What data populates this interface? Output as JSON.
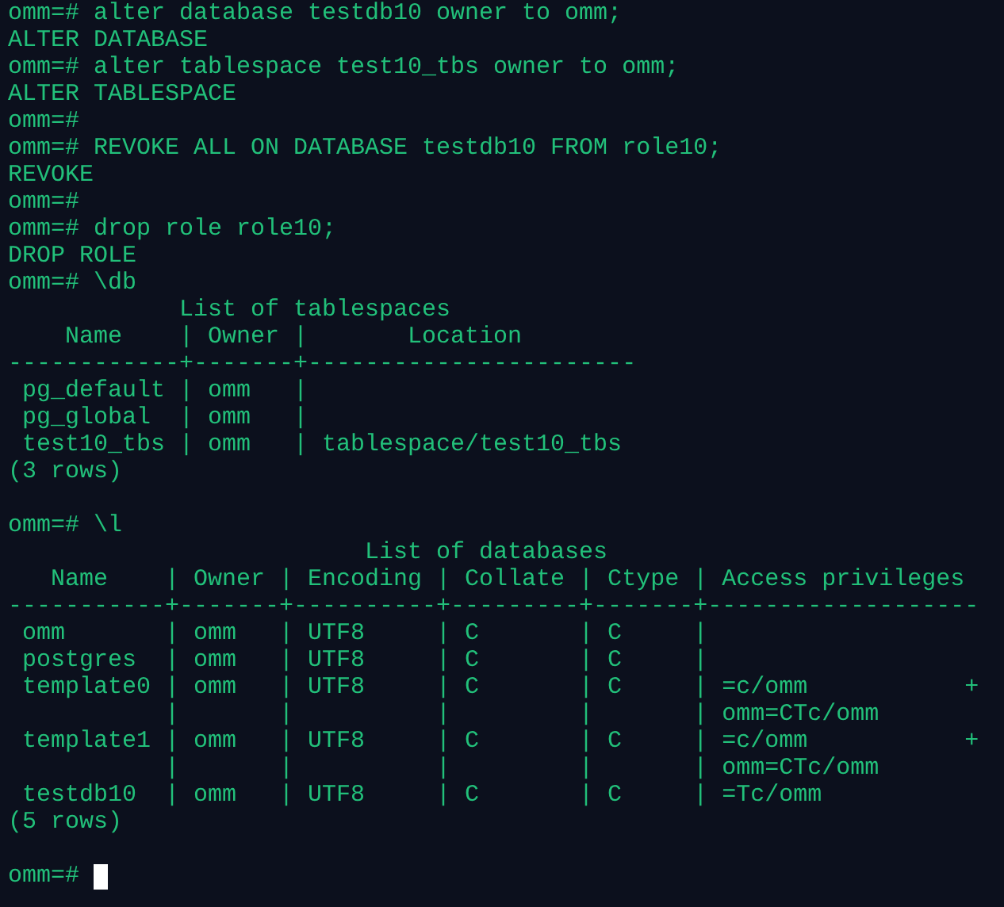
{
  "terminal": {
    "lines": [
      {
        "kind": "text",
        "text": "omm=# alter database testdb10 owner to omm;"
      },
      {
        "kind": "text",
        "text": "ALTER DATABASE"
      },
      {
        "kind": "text",
        "text": "omm=# alter tablespace test10_tbs owner to omm;"
      },
      {
        "kind": "text",
        "text": "ALTER TABLESPACE"
      },
      {
        "kind": "text",
        "text": "omm=#"
      },
      {
        "kind": "text",
        "text": "omm=# REVOKE ALL ON DATABASE testdb10 FROM role10;"
      },
      {
        "kind": "text",
        "text": "REVOKE"
      },
      {
        "kind": "text",
        "text": "omm=#"
      },
      {
        "kind": "text",
        "text": "omm=# drop role role10;"
      },
      {
        "kind": "text",
        "text": "DROP ROLE"
      },
      {
        "kind": "text",
        "text": "omm=# \\db"
      },
      {
        "kind": "text",
        "text": "            List of tablespaces"
      },
      {
        "kind": "text",
        "text": "    Name    | Owner |       Location"
      },
      {
        "kind": "text",
        "text": "------------+-------+-----------------------"
      },
      {
        "kind": "text",
        "text": " pg_default | omm   |"
      },
      {
        "kind": "text",
        "text": " pg_global  | omm   |"
      },
      {
        "kind": "text",
        "text": " test10_tbs | omm   | tablespace/test10_tbs"
      },
      {
        "kind": "text",
        "text": "(3 rows)"
      },
      {
        "kind": "blank"
      },
      {
        "kind": "text",
        "text": "omm=# \\l"
      },
      {
        "kind": "text",
        "text": "                         List of databases"
      },
      {
        "kind": "text",
        "text": "   Name    | Owner | Encoding | Collate | Ctype | Access privileges"
      },
      {
        "kind": "text",
        "text": "-----------+-------+----------+---------+-------+-------------------"
      },
      {
        "kind": "text",
        "text": " omm       | omm   | UTF8     | C       | C     |"
      },
      {
        "kind": "text",
        "text": " postgres  | omm   | UTF8     | C       | C     |"
      },
      {
        "kind": "text",
        "text": " template0 | omm   | UTF8     | C       | C     | =c/omm           +"
      },
      {
        "kind": "text",
        "text": "           |       |          |         |       | omm=CTc/omm"
      },
      {
        "kind": "text",
        "text": " template1 | omm   | UTF8     | C       | C     | =c/omm           +"
      },
      {
        "kind": "text",
        "text": "           |       |          |         |       | omm=CTc/omm"
      },
      {
        "kind": "text",
        "text": " testdb10  | omm   | UTF8     | C       | C     | =Tc/omm"
      },
      {
        "kind": "text",
        "text": "(5 rows)"
      },
      {
        "kind": "blank"
      },
      {
        "kind": "text",
        "text": "omm=#",
        "cursor": true
      }
    ]
  }
}
